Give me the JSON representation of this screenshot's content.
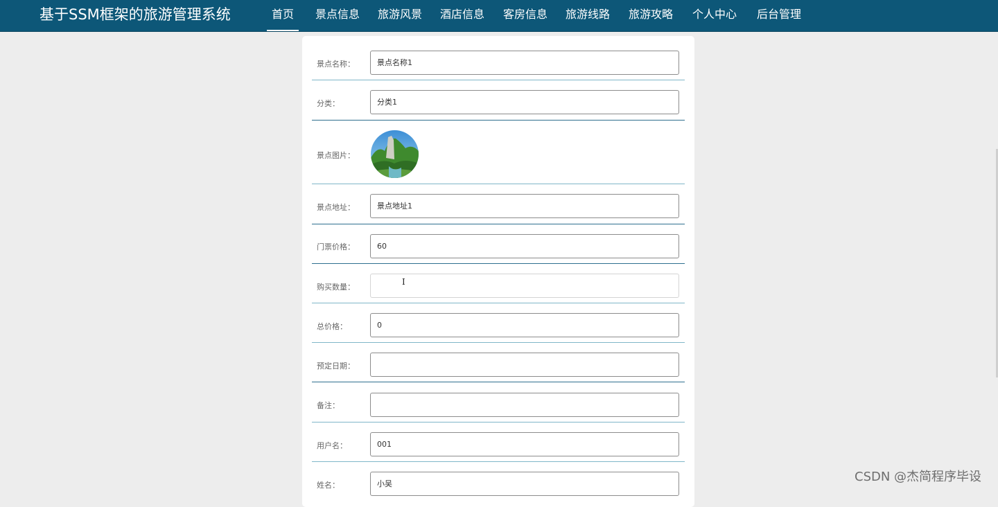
{
  "header": {
    "title": "基于SSM框架的旅游管理系统",
    "nav": [
      {
        "label": "首页",
        "active": true
      },
      {
        "label": "景点信息",
        "active": false
      },
      {
        "label": "旅游风景",
        "active": false
      },
      {
        "label": "酒店信息",
        "active": false
      },
      {
        "label": "客房信息",
        "active": false
      },
      {
        "label": "旅游线路",
        "active": false
      },
      {
        "label": "旅游攻略",
        "active": false
      },
      {
        "label": "个人中心",
        "active": false
      },
      {
        "label": "后台管理",
        "active": false
      }
    ]
  },
  "form": {
    "fields": [
      {
        "label": "景点名称：",
        "value": "景点名称1"
      },
      {
        "label": "分类：",
        "value": "分类1"
      },
      {
        "label": "景点图片：",
        "image": "scenic-photo"
      },
      {
        "label": "景点地址：",
        "value": "景点地址1"
      },
      {
        "label": "门票价格：",
        "value": "60"
      },
      {
        "label": "购买数量：",
        "value": ""
      },
      {
        "label": "总价格：",
        "value": "0"
      },
      {
        "label": "预定日期：",
        "value": ""
      },
      {
        "label": "备注：",
        "value": ""
      },
      {
        "label": "用户名：",
        "value": "001"
      },
      {
        "label": "姓名：",
        "value": "小吴"
      }
    ]
  },
  "watermark": "CSDN @杰简程序毕设",
  "colors": {
    "nav_bg": "#0d5778",
    "page_bg": "#ededed",
    "divider": "#2d6e8e"
  }
}
